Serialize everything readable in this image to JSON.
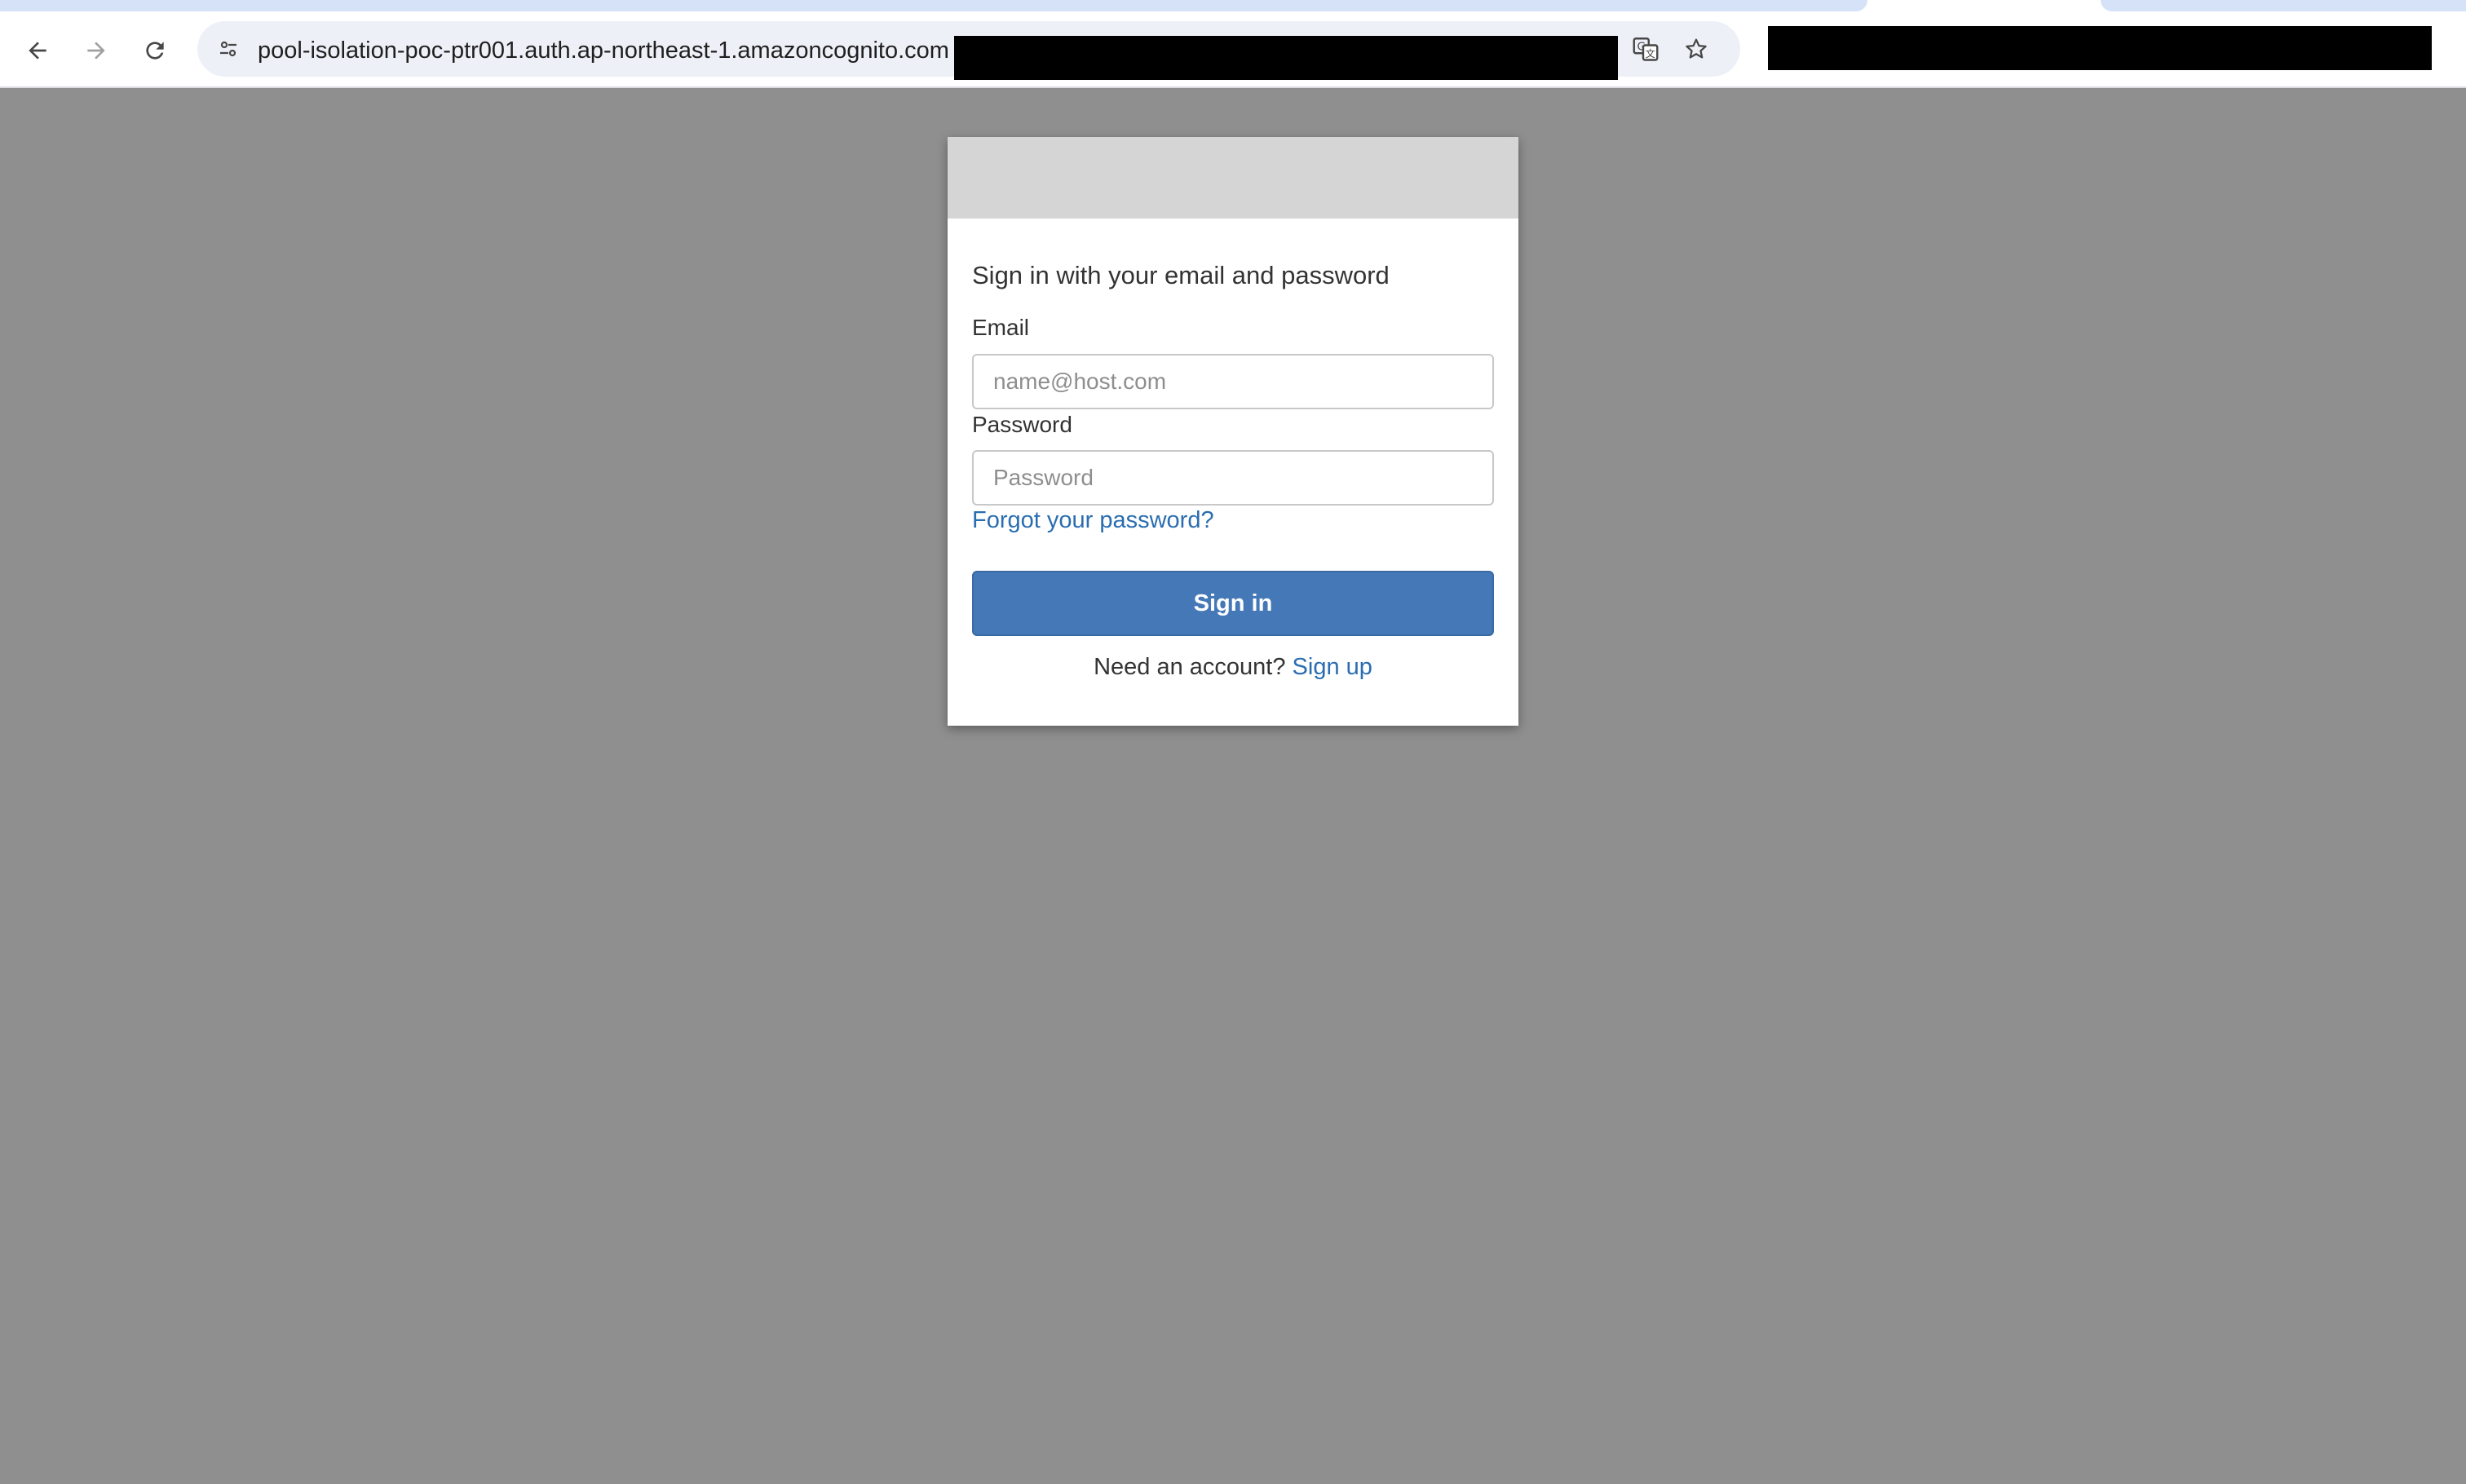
{
  "browser": {
    "url": "pool-isolation-poc-ptr001.auth.ap-northeast-1.amazoncognito.com"
  },
  "login": {
    "heading": "Sign in with your email and password",
    "email_label": "Email",
    "email_placeholder": "name@host.com",
    "password_label": "Password",
    "password_placeholder": "Password",
    "forgot_link": "Forgot your password?",
    "signin_button": "Sign in",
    "signup_prompt": "Need an account?",
    "signup_link": "Sign up"
  },
  "colors": {
    "page_background": "#8f8f8f",
    "primary_button": "#4478b6",
    "link": "#2a6db0",
    "banner": "#d5d5d5"
  }
}
